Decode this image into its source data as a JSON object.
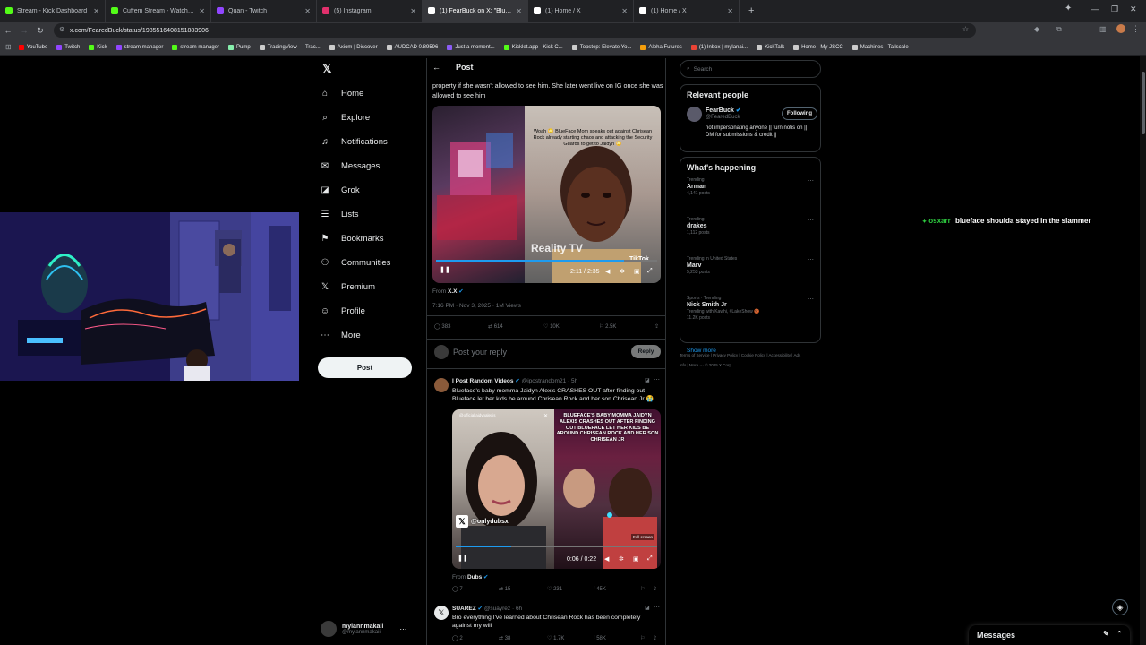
{
  "browser": {
    "tabs": [
      {
        "label": "Stream - Kick Dashboard",
        "color": "#53fc18",
        "active": false
      },
      {
        "label": "Cuffem Stream - Watch Live on",
        "color": "#53fc18",
        "active": false
      },
      {
        "label": "Quan - Twitch",
        "color": "#9146ff",
        "active": false
      },
      {
        "label": "(5) Instagram",
        "color": "#e1306c",
        "active": false
      },
      {
        "label": "(1) FearBuck on X: \"Bluefac",
        "color": "#ffffff",
        "active": true
      },
      {
        "label": "(1) Home / X",
        "color": "#ffffff",
        "active": false
      },
      {
        "label": "(1) Home / X",
        "color": "#ffffff",
        "active": false
      }
    ],
    "new_tab": "+",
    "url": "x.com/FearedBuck/status/1985516408151883906",
    "bookmarks": [
      {
        "label": "YouTube",
        "color": "#ff0000"
      },
      {
        "label": "Twitch",
        "color": "#9146ff"
      },
      {
        "label": "Kick",
        "color": "#53fc18"
      },
      {
        "label": "stream manager",
        "color": "#9146ff"
      },
      {
        "label": "stream manager",
        "color": "#53fc18"
      },
      {
        "label": "Pump",
        "color": "#86efac"
      },
      {
        "label": "TradingView — Trac...",
        "color": "#cccccc"
      },
      {
        "label": "Axiom | Discover",
        "color": "#cccccc"
      },
      {
        "label": "AUDCAD 0.89596",
        "color": "#cccccc"
      },
      {
        "label": "Just a moment...",
        "color": "#8b5cf6"
      },
      {
        "label": "Kicklet.app - Kick C...",
        "color": "#53fc18"
      },
      {
        "label": "Topstep: Elevate Yo...",
        "color": "#cccccc"
      },
      {
        "label": "Alpha Futures",
        "color": "#f59e0b"
      },
      {
        "label": "(1) Inbox | mylanai...",
        "color": "#ea4335"
      },
      {
        "label": "KickTalk",
        "color": "#cccccc"
      },
      {
        "label": "Home - My JSCC",
        "color": "#cccccc"
      },
      {
        "label": "Machines - Tailscale",
        "color": "#cccccc"
      }
    ]
  },
  "x_nav": {
    "items": [
      {
        "icon": "home-icon",
        "glyph": "⌂",
        "label": "Home"
      },
      {
        "icon": "search-icon",
        "glyph": "⌕",
        "label": "Explore"
      },
      {
        "icon": "bell-icon",
        "glyph": "♫",
        "label": "Notifications"
      },
      {
        "icon": "mail-icon",
        "glyph": "✉",
        "label": "Messages"
      },
      {
        "icon": "grok-icon",
        "glyph": "◪",
        "label": "Grok"
      },
      {
        "icon": "list-icon",
        "glyph": "☰",
        "label": "Lists"
      },
      {
        "icon": "bookmark-icon",
        "glyph": "⚑",
        "label": "Bookmarks"
      },
      {
        "icon": "people-icon",
        "glyph": "⚇",
        "label": "Communities"
      },
      {
        "icon": "x-logo-icon",
        "glyph": "𝕏",
        "label": "Premium"
      },
      {
        "icon": "user-icon",
        "glyph": "☺",
        "label": "Profile"
      },
      {
        "icon": "more-icon",
        "glyph": "⋯",
        "label": "More"
      }
    ],
    "post_button": "Post",
    "user_name": "mylannmakaii",
    "user_handle": "@mylannmakaii"
  },
  "post": {
    "header": "Post",
    "text": "property if she wasn't allowed to see him. She later went live on IG once she was allowed to see him",
    "video": {
      "caption": "Woah 😳 BlueFace Mom speaks out against Chrisean Rock already starting chaos and attacking the Security Guards to get to Jaidyn 😳",
      "watermark": "Reality TV",
      "tiktok": "TikTok",
      "time": "2:11 / 2:35"
    },
    "from": "From",
    "from_account": "X.X",
    "meta": "7:16 PM · Nov 3, 2025 · 1M Views",
    "stats": {
      "replies": "383",
      "reposts": "614",
      "likes": "10K",
      "bookmarks": "2.5K"
    },
    "reply_placeholder": "Post your reply",
    "reply_button": "Reply"
  },
  "reply1": {
    "name": "I Post Random Videos",
    "handle": "@ipostrandom21 · 5h",
    "text": "Blueface's baby momma Jaidyn Alexis CRASHES OUT after finding out Blueface let her kids be around Chrisean Rock and her son Chrisean Jr 😭",
    "video": {
      "overlay": "BLUEFACE'S BABY MOMMA JAIDYN ALEXIS CRASHES OUT AFTER FINDING OUT BLUEFACE LET HER KIDS BE AROUND CHRISEAN ROCK AND HER SON CHRISEAN JR",
      "tag": "@onlydubsx",
      "fullscreen": "Full screen",
      "time": "0:06 / 0:22"
    },
    "from": "From",
    "from_account": "Dubs",
    "stats": {
      "replies": "7",
      "reposts": "15",
      "likes": "231",
      "views": "45K"
    }
  },
  "reply2": {
    "name": "SUAREZ",
    "handle": "@suayrez · 6h",
    "text": "Bro everything I've learned about Chrisean Rock has been completely against my will",
    "stats": {
      "replies": "2",
      "reposts": "38",
      "likes": "1.7K",
      "views": "58K"
    }
  },
  "sidebar": {
    "search_placeholder": "Search",
    "relevant_title": "Relevant people",
    "person": {
      "name": "FearBuck",
      "handle": "@FearedBuck",
      "button": "Following",
      "bio": "not impersonating anyone || turn notis on || DM for submissions & credit ||"
    },
    "happening_title": "What's happening",
    "trends": [
      {
        "context": "Trending",
        "name": "Arman",
        "count": "4,141 posts",
        "extra": ""
      },
      {
        "context": "Trending",
        "name": "drakes",
        "count": "1,112 posts",
        "extra": ""
      },
      {
        "context": "Trending in United States",
        "name": "Marv",
        "count": "5,253 posts",
        "extra": ""
      },
      {
        "context": "Sports · Trending",
        "name": "Nick Smith Jr",
        "count": "11.2K posts",
        "extra": "Trending with Kawhi, #LakeShow 🏀"
      }
    ],
    "show_more": "Show more",
    "footer": "Terms of Service | Privacy Policy | Cookie Policy | Accessibility | Ads info | More ··· © 2025 X Corp."
  },
  "chat": {
    "user": "osxarr",
    "message": "blueface shoulda stayed in the slammer"
  },
  "messages_bar": {
    "label": "Messages"
  }
}
